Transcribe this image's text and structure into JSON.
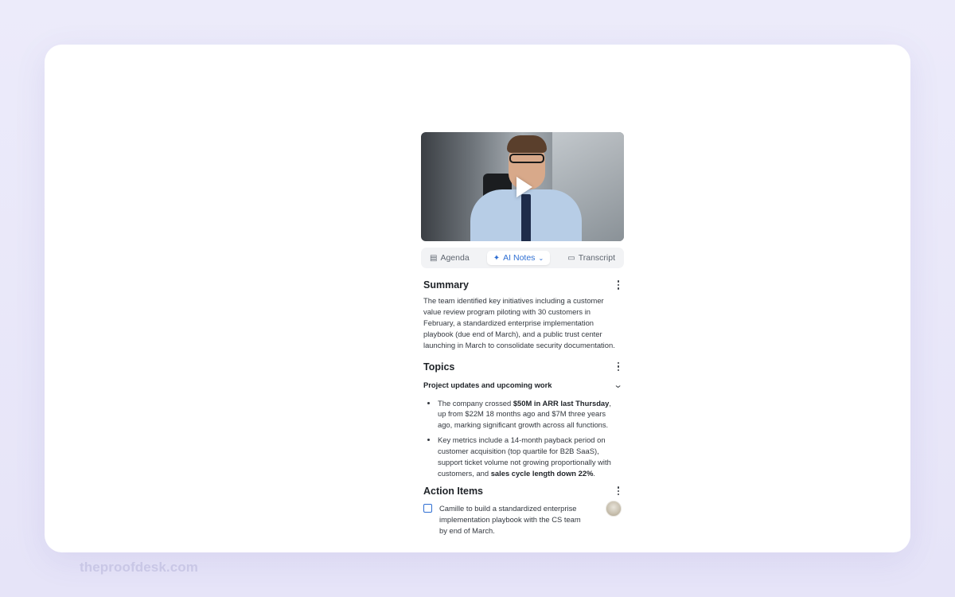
{
  "tabs": {
    "agenda": "Agenda",
    "ai_notes": "AI Notes",
    "transcript": "Transcript"
  },
  "summary": {
    "title": "Summary",
    "text": "The team identified key initiatives including a customer value review program piloting with 30 customers in February, a standardized enterprise implementation playbook (due end of March), and a public trust center launching in March to consolidate security documentation."
  },
  "topics": {
    "title": "Topics",
    "topic_title": "Project updates and upcoming work",
    "bullets": [
      {
        "pre": "The company crossed ",
        "bold": "$50M in ARR last Thursday",
        "post": ", up from $22M 18 months ago and $7M three years ago, marking significant growth across all functions."
      },
      {
        "pre": "Key metrics include a 14-month payback period on customer acquisition (top quartile for B2B SaaS), support ticket volume not growing proportionally with customers, and ",
        "bold": "sales cycle length down 22%",
        "post": "."
      }
    ]
  },
  "action_items": {
    "title": "Action Items",
    "items": [
      {
        "text": "Camille to build a standardized enterprise implementation playbook with the CS team by end of March.",
        "checked": false
      }
    ]
  },
  "watermark": "theproofdesk.com",
  "colors": {
    "accent": "#2f6fd3",
    "background": "#ecebfa"
  }
}
